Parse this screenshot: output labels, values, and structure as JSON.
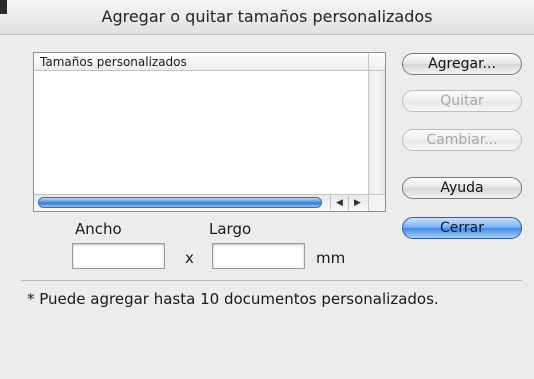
{
  "window": {
    "title": "Agregar o quitar tamaños personalizados"
  },
  "list": {
    "header": "Tamaños personalizados",
    "items": [],
    "hscroll_arrows": [
      "◀",
      "▶"
    ]
  },
  "buttons": {
    "add": "Agregar...",
    "remove": "Quitar",
    "change": "Cambiar...",
    "help": "Ayuda",
    "close": "Cerrar"
  },
  "size": {
    "width_label": "Ancho",
    "height_label": "Largo",
    "separator": "x",
    "unit": "mm",
    "width_value": "",
    "height_value": ""
  },
  "note": "* Puede agregar hasta 10 documentos personalizados.",
  "colors": {
    "default_button": "#3f88e6",
    "scroll_thumb": "#4f8fdc"
  }
}
